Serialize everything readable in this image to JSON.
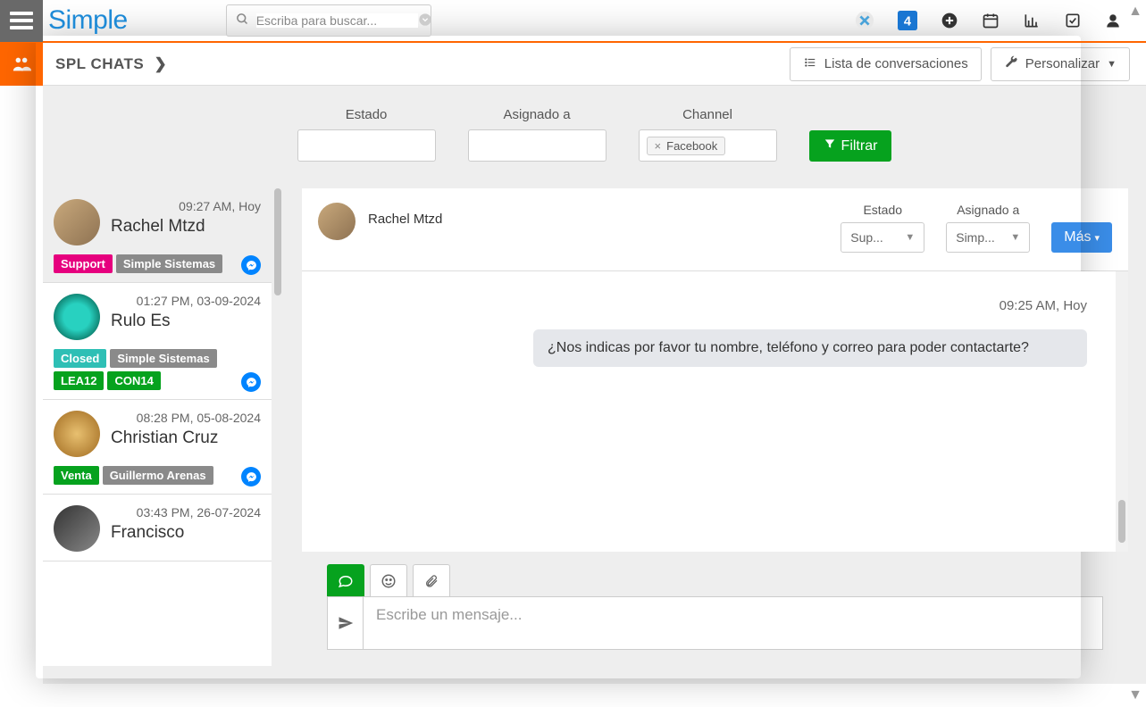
{
  "logo": "Simple",
  "search": {
    "placeholder": "Escriba para buscar..."
  },
  "module": {
    "title": "SPL CHATS"
  },
  "subButtons": {
    "listConversations": "Lista de conversaciones",
    "customize": "Personalizar"
  },
  "filters": {
    "estadoLabel": "Estado",
    "asignadoLabel": "Asignado a",
    "channelLabel": "Channel",
    "channelTag": "Facebook",
    "filterBtn": "Filtrar"
  },
  "conversations": [
    {
      "time": "09:27 AM, Hoy",
      "name": "Rachel Mtzd",
      "tags": [
        {
          "label": "Support",
          "cls": "support"
        },
        {
          "label": "Simple Sistemas",
          "cls": "grey"
        }
      ]
    },
    {
      "time": "01:27 PM, 03-09-2024",
      "name": "Rulo Es",
      "tags": [
        {
          "label": "Closed",
          "cls": "closed"
        },
        {
          "label": "Simple Sistemas",
          "cls": "grey"
        },
        {
          "label": "LEA12",
          "cls": "green"
        },
        {
          "label": "CON14",
          "cls": "green"
        }
      ]
    },
    {
      "time": "08:28 PM, 05-08-2024",
      "name": "Christian Cruz",
      "tags": [
        {
          "label": "Venta",
          "cls": "green"
        },
        {
          "label": "Guillermo Arenas",
          "cls": "grey"
        }
      ]
    },
    {
      "time": "03:43 PM, 26-07-2024",
      "name": "Francisco",
      "tags": []
    }
  ],
  "chat": {
    "contactName": "Rachel Mtzd",
    "estadoLabel": "Estado",
    "estadoValue": "Sup...",
    "asignadoLabel": "Asignado a",
    "asignadoValue": "Simp...",
    "moreBtn": "Más",
    "msgTime": "09:25 AM, Hoy",
    "msgText": "¿Nos indicas por favor tu nombre, teléfono y correo para poder contactarte?",
    "composerPlaceholder": "Escribe un mensaje..."
  }
}
